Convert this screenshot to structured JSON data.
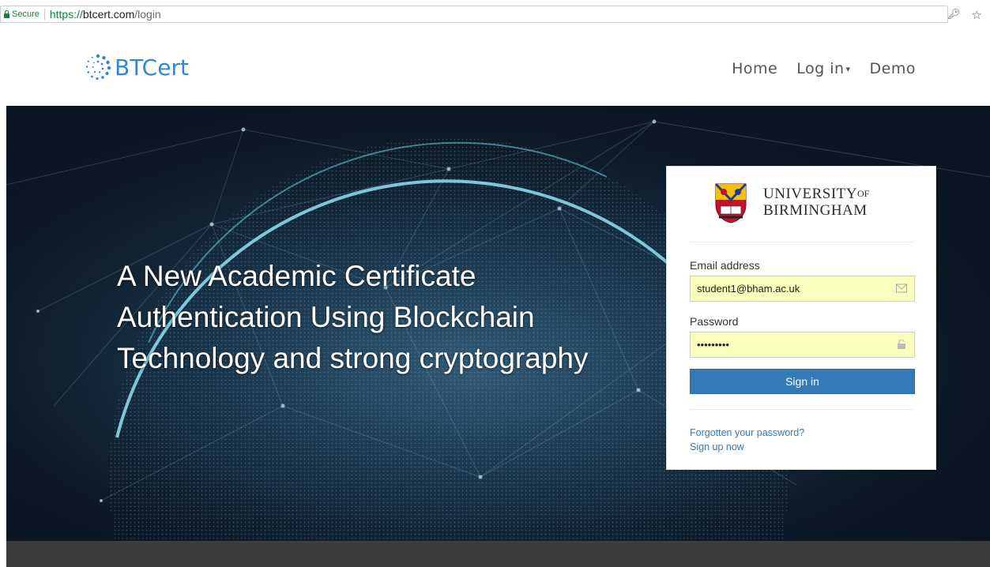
{
  "browser": {
    "secure_label": "Secure",
    "url_scheme": "https://",
    "url_host": "btcert.com",
    "url_path": "/login"
  },
  "header": {
    "brand": "BTCert",
    "nav": {
      "home": "Home",
      "login": "Log in",
      "demo": "Demo"
    }
  },
  "hero": {
    "headline_lines": [
      "A New Academic Certificate",
      "Authentication Using Blockchain",
      "Technology and strong cryptography"
    ]
  },
  "login": {
    "university_line1": "UNIVERSITY",
    "university_of": "OF",
    "university_line2": "BIRMINGHAM",
    "email_label": "Email address",
    "email_value": "student1@bham.ac.uk",
    "password_label": "Password",
    "password_value": "•••••••••",
    "signin_label": "Sign in",
    "forgot_link": "Forgotten your password?",
    "signup_link": "Sign up now"
  },
  "colors": {
    "brand_blue": "#2b88d8",
    "button_blue": "#337ab7",
    "autofill_yellow": "#faffbd",
    "secure_green": "#188038",
    "hero_dark": "#0c1825",
    "footer_gray": "#3d3d3d"
  },
  "icons": {
    "secure": "lock-icon",
    "key": "key-icon",
    "bookmark": "star-icon",
    "brand": "btcert-logo-icon",
    "email": "envelope-icon",
    "password": "unlock-icon",
    "crest": "university-crest-icon"
  }
}
